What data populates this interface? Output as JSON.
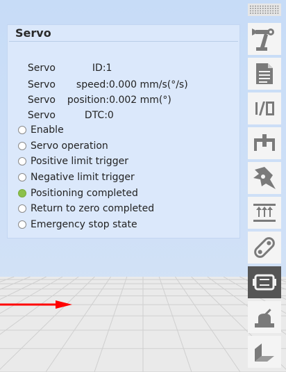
{
  "panel": {
    "title": "Servo",
    "rows": [
      {
        "label": "Servo",
        "value": "ID:1"
      },
      {
        "label": "Servo",
        "value": "speed:0.000 mm/s(°/s)"
      },
      {
        "label": "Servo",
        "value": "position:0.002 mm(°)"
      },
      {
        "label": "Servo",
        "value": "DTC:0"
      }
    ],
    "status": [
      {
        "label": "Enable",
        "on": false
      },
      {
        "label": "Servo operation",
        "on": false
      },
      {
        "label": "Positive limit trigger",
        "on": false
      },
      {
        "label": "Negative limit trigger",
        "on": false
      },
      {
        "label": "Positioning completed",
        "on": true
      },
      {
        "label": "Return to zero completed",
        "on": false
      },
      {
        "label": "Emergency stop state",
        "on": false
      }
    ]
  },
  "toolbar": {
    "items": [
      {
        "name": "robot-arm-icon",
        "text": ""
      },
      {
        "name": "document-icon",
        "text": ""
      },
      {
        "name": "io-icon",
        "text": "I/O"
      },
      {
        "name": "gripper-icon",
        "text": ""
      },
      {
        "name": "star-tool-icon",
        "text": ""
      },
      {
        "name": "axes-icon",
        "text": ""
      },
      {
        "name": "conveyor-icon",
        "text": ""
      },
      {
        "name": "servo-icon",
        "text": "",
        "active": true
      },
      {
        "name": "joystick-icon",
        "text": ""
      },
      {
        "name": "corner-icon",
        "text": ""
      }
    ]
  },
  "colors": {
    "active_status": "#8cc04b",
    "axis_red": "#ff0000",
    "toolbar_active": "#555555"
  }
}
